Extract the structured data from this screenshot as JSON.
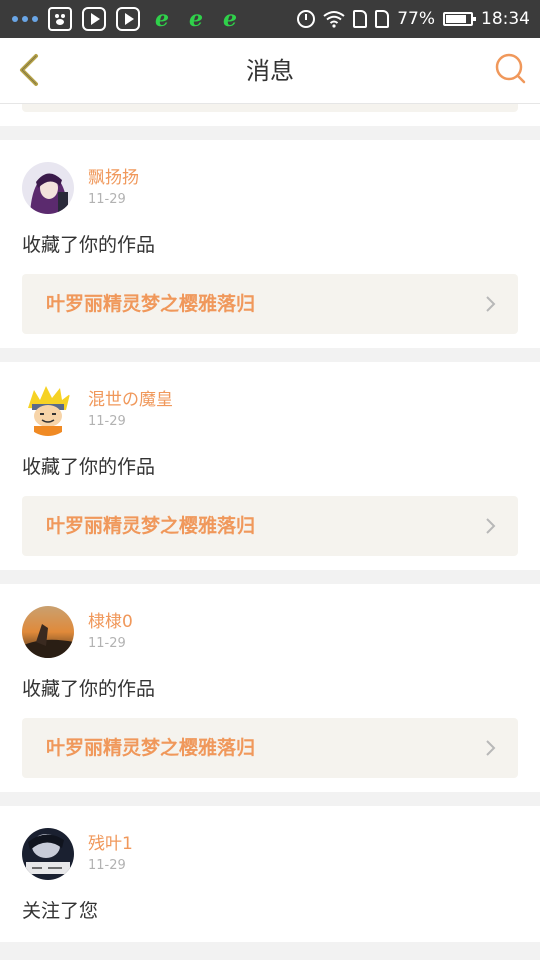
{
  "status_bar": {
    "battery": "77%",
    "time": "18:34"
  },
  "header": {
    "title": "消息",
    "back_icon": "back-chevron-icon",
    "search_icon": "search-icon"
  },
  "colors": {
    "accent": "#f0985b",
    "work_bg": "#f5f3ee",
    "back_icon": "#b7a347"
  },
  "messages": [
    {
      "username": "飘扬扬",
      "date": "11-29",
      "action": "收藏了你的作品",
      "work_title": "叶罗丽精灵梦之樱雅落归"
    },
    {
      "username": "混世の魔皇",
      "date": "11-29",
      "action": "收藏了你的作品",
      "work_title": "叶罗丽精灵梦之樱雅落归"
    },
    {
      "username": "棣棣0",
      "date": "11-29",
      "action": "收藏了你的作品",
      "work_title": "叶罗丽精灵梦之樱雅落归"
    },
    {
      "username": "残叶1",
      "date": "11-29",
      "action": "关注了您"
    }
  ]
}
